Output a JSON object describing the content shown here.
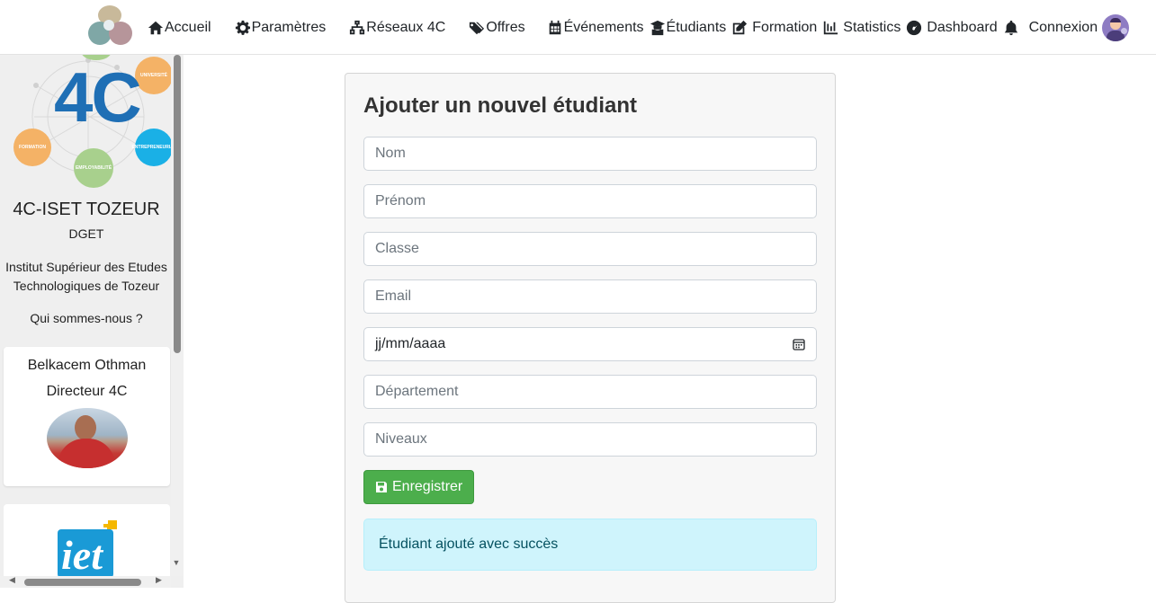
{
  "nav": {
    "items": [
      {
        "label": "Accueil",
        "icon": "home-icon"
      },
      {
        "label": "Paramètres",
        "icon": "gear-icon"
      },
      {
        "label": "Réseaux 4C",
        "icon": "network-icon"
      },
      {
        "label": "Offres",
        "icon": "tags-icon"
      },
      {
        "label": "Événements",
        "icon": "calendar-icon"
      },
      {
        "label": "Étudiants",
        "icon": "graduate-icon"
      },
      {
        "label": "Formation",
        "icon": "edit-icon"
      },
      {
        "label": "Statistics",
        "icon": "chart-icon"
      },
      {
        "label": "Dashboard",
        "icon": "dashboard-icon"
      },
      {
        "label": "Connexion",
        "icon": "bell-icon"
      }
    ]
  },
  "sidebar": {
    "logo_bubbles": [
      "UNIVERSITÉ",
      "FORMATION",
      "ENTREPRENEURIAT",
      "EMPLOYABILITÉ"
    ],
    "logo_text": "4C",
    "title": "4C-ISET TOZEUR",
    "subtitle": "DGET",
    "institute": "Institut Supérieur des Etudes Technologiques de Tozeur",
    "about": "Qui sommes-nous ?",
    "director": {
      "name": "Belkacem Othman",
      "role": "Directeur 4C"
    }
  },
  "form": {
    "title": "Ajouter un nouvel étudiant",
    "placeholders": {
      "nom": "Nom",
      "prenom": "Prénom",
      "classe": "Classe",
      "email": "Email",
      "date": "jj/mm/aaaa",
      "departement": "Département",
      "niveaux": "Niveaux"
    },
    "save_label": "Enregistrer",
    "success_message": "Étudiant ajouté avec succès"
  },
  "colors": {
    "accent_green": "#4cae4c",
    "alert_bg": "#cff4fc",
    "logo_blue": "#1f6fb5"
  }
}
